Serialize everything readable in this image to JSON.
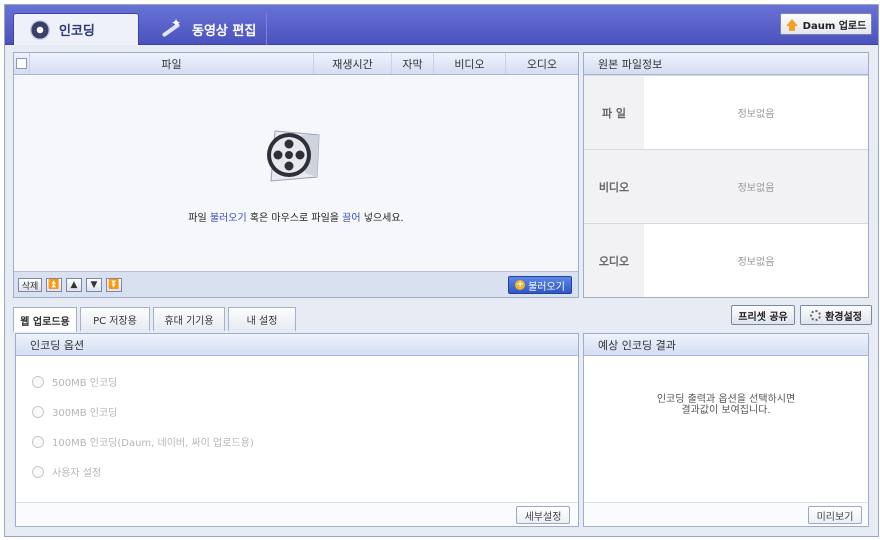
{
  "tabs": {
    "encoding": "인코딩",
    "video_edit": "동영상 편집"
  },
  "daum_upload": "Daum 업로드",
  "file_list": {
    "columns": [
      "파일",
      "재생시간",
      "자막",
      "비디오",
      "오디오"
    ],
    "drop_message": {
      "pre": "파일 ",
      "link1": "불러오기",
      "mid": " 혹은 마우스로 파일을 ",
      "link2": "끌어",
      "post": " 넣으세요."
    },
    "delete_label": "삭제",
    "load_label": "불러오기"
  },
  "source_info": {
    "title": "원본 파일정보",
    "rows": [
      {
        "label": "파  일",
        "value": "정보없음"
      },
      {
        "label": "비디오",
        "value": "정보없음"
      },
      {
        "label": "오디오",
        "value": "정보없음"
      }
    ]
  },
  "sub_tabs": [
    "웹 업로드용",
    "PC 저장용",
    "휴대 기기용",
    "내 설정"
  ],
  "preset_share": "프리셋 공유",
  "env_settings": "환경설정",
  "encoding_options": {
    "title": "인코딩 옵션",
    "options": [
      "500MB 인코딩",
      "300MB 인코딩",
      "100MB 인코딩(Daum, 네이버, 싸이 업로드용)",
      "사용자 설정"
    ],
    "detail_button": "세부설정"
  },
  "expected_result": {
    "title": "예상 인코딩 결과",
    "line1": "인코딩 출력과 옵션을 선택하시면",
    "line2": "결과값이 보여집니다.",
    "preview_button": "미리보기"
  }
}
